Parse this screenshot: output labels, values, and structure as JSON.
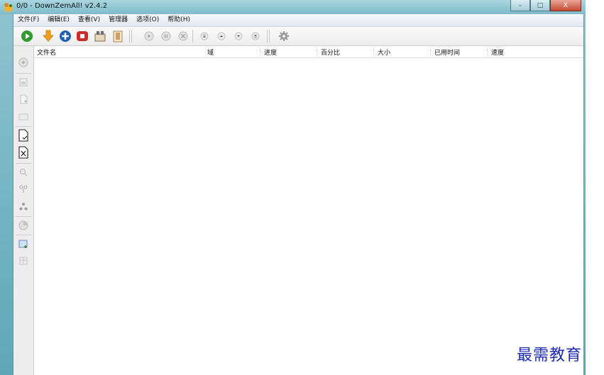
{
  "window": {
    "title": "0/0 - DownZemAll! v2.4.2",
    "controls": {
      "minimize": "–",
      "maximize": "□",
      "close": "X"
    }
  },
  "menu": [
    {
      "id": "file",
      "label": "文件(F)"
    },
    {
      "id": "edit",
      "label": "编辑(E)"
    },
    {
      "id": "view",
      "label": "查看(V)"
    },
    {
      "id": "manager",
      "label": "管理器"
    },
    {
      "id": "options",
      "label": "选项(O)"
    },
    {
      "id": "help",
      "label": "帮助(H)"
    }
  ],
  "toolbar": {
    "icons": [
      "start-icon",
      "download-icon",
      "add-icon",
      "stop-icon",
      "queue-icon",
      "clipboard-icon",
      "resume-icon",
      "pause-icon",
      "cancel-icon",
      "move-top-icon",
      "move-up-icon",
      "move-down-icon",
      "move-bottom-icon",
      "settings-icon"
    ]
  },
  "sidebar": {
    "icons": [
      "info-icon",
      "page-icon",
      "file-icon",
      "folder-icon",
      "check-file-icon",
      "remove-file-icon",
      "search-icon",
      "filter-icon",
      "tree-icon",
      "stats-icon",
      "add-folder-icon",
      "grid-icon"
    ]
  },
  "list": {
    "columns": [
      {
        "id": "filename",
        "label": "文件名"
      },
      {
        "id": "domain",
        "label": "域"
      },
      {
        "id": "progress",
        "label": "进度"
      },
      {
        "id": "percent",
        "label": "百分比"
      },
      {
        "id": "size",
        "label": "大小"
      },
      {
        "id": "elapsed",
        "label": "已用时间"
      },
      {
        "id": "speed",
        "label": "速度"
      }
    ],
    "rows": []
  },
  "watermark": "最需教育",
  "colors": {
    "titlebar": "#7ebccb",
    "client_bg": "#f0f0f0",
    "list_bg": "#ffffff",
    "watermark": "#1f2bb3",
    "start_green": "#2f9a2f",
    "add_blue": "#1e5fb7",
    "stop_red": "#cc2b2b",
    "download_orange": "#f0a020"
  }
}
